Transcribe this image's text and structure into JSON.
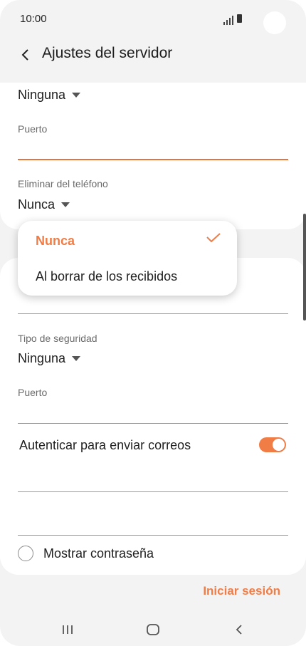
{
  "status_bar": {
    "time": "10:00"
  },
  "header": {
    "title": "Ajustes del servidor"
  },
  "top_card": {
    "security_value": "Ninguna",
    "port_label": "Puerto",
    "delete_label": "Eliminar del teléfono",
    "delete_value": "Nunca"
  },
  "popup": {
    "options": [
      {
        "label": "Nunca",
        "selected": true
      },
      {
        "label": "Al borrar de los recibidos",
        "selected": false
      }
    ]
  },
  "bottom_card": {
    "security_label": "Tipo de seguridad",
    "security_value": "Ninguna",
    "port_label": "Puerto",
    "auth_label": "Autenticar para enviar correos",
    "auth_enabled": true,
    "show_password_label": "Mostrar contraseña"
  },
  "footer": {
    "signin_label": "Iniciar sesión"
  },
  "colors": {
    "accent": "#f07c46",
    "background": "#f3f3f3",
    "card": "#ffffff"
  },
  "icons": [
    "back-arrow-icon",
    "signal-icon",
    "battery-icon",
    "caret-down-icon",
    "checkmark-icon",
    "recent-apps-icon",
    "home-icon",
    "nav-back-icon"
  ]
}
